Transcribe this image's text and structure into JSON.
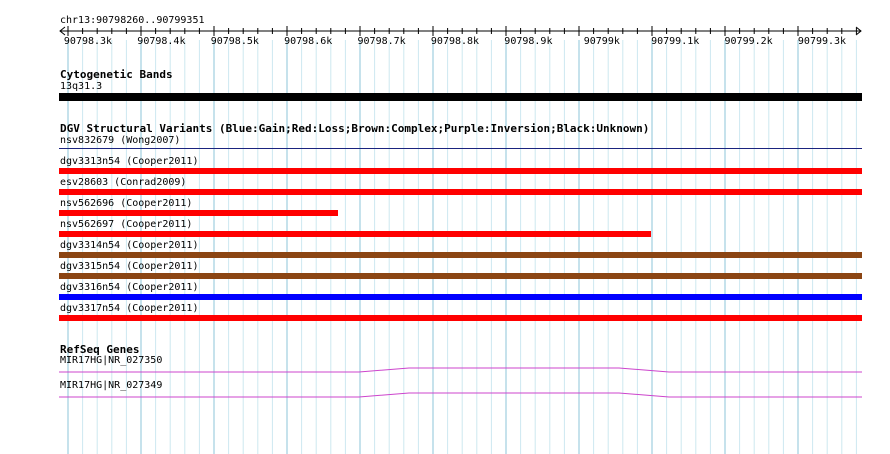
{
  "header": {
    "region": "chr13:90798260..90799351"
  },
  "ruler": {
    "ticks": [
      "90798.3k",
      "90798.4k",
      "90798.5k",
      "90798.6k",
      "90798.7k",
      "90798.8k",
      "90798.9k",
      "90799k",
      "90799.1k",
      "90799.2k",
      "90799.3k"
    ]
  },
  "cytoband_track": {
    "title": "Cytogenetic Bands",
    "label": "13q31.3",
    "color": "#000000"
  },
  "dgv_track": {
    "title": "DGV Structural Variants (Blue:Gain;Red:Loss;Brown:Complex;Purple:Inversion;Black:Unknown)",
    "features": [
      {
        "label": "nsv832679 (Wong2007)",
        "color": "#1a237e",
        "type": "line"
      },
      {
        "label": "dgv3313n54 (Cooper2011)",
        "color": "#ff0000",
        "type": "bar"
      },
      {
        "label": "esv28603 (Conrad2009)",
        "color": "#ff0000",
        "type": "bar"
      },
      {
        "label": "nsv562696 (Cooper2011)",
        "color": "#ff0000",
        "type": "bar"
      },
      {
        "label": "nsv562697 (Cooper2011)",
        "color": "#ff0000",
        "type": "bar"
      },
      {
        "label": "dgv3314n54 (Cooper2011)",
        "color": "#8b4513",
        "type": "bar"
      },
      {
        "label": "dgv3315n54 (Cooper2011)",
        "color": "#8b4513",
        "type": "bar"
      },
      {
        "label": "dgv3316n54 (Cooper2011)",
        "color": "#0000ff",
        "type": "bar"
      },
      {
        "label": "dgv3317n54 (Cooper2011)",
        "color": "#ff0000",
        "type": "bar"
      }
    ]
  },
  "refseq_track": {
    "title": "RefSeq Genes",
    "features": [
      {
        "label": "MIR17HG|NR_027350",
        "color": "#cc44cc"
      },
      {
        "label": "MIR17HG|NR_027349",
        "color": "#cc44cc"
      }
    ]
  }
}
